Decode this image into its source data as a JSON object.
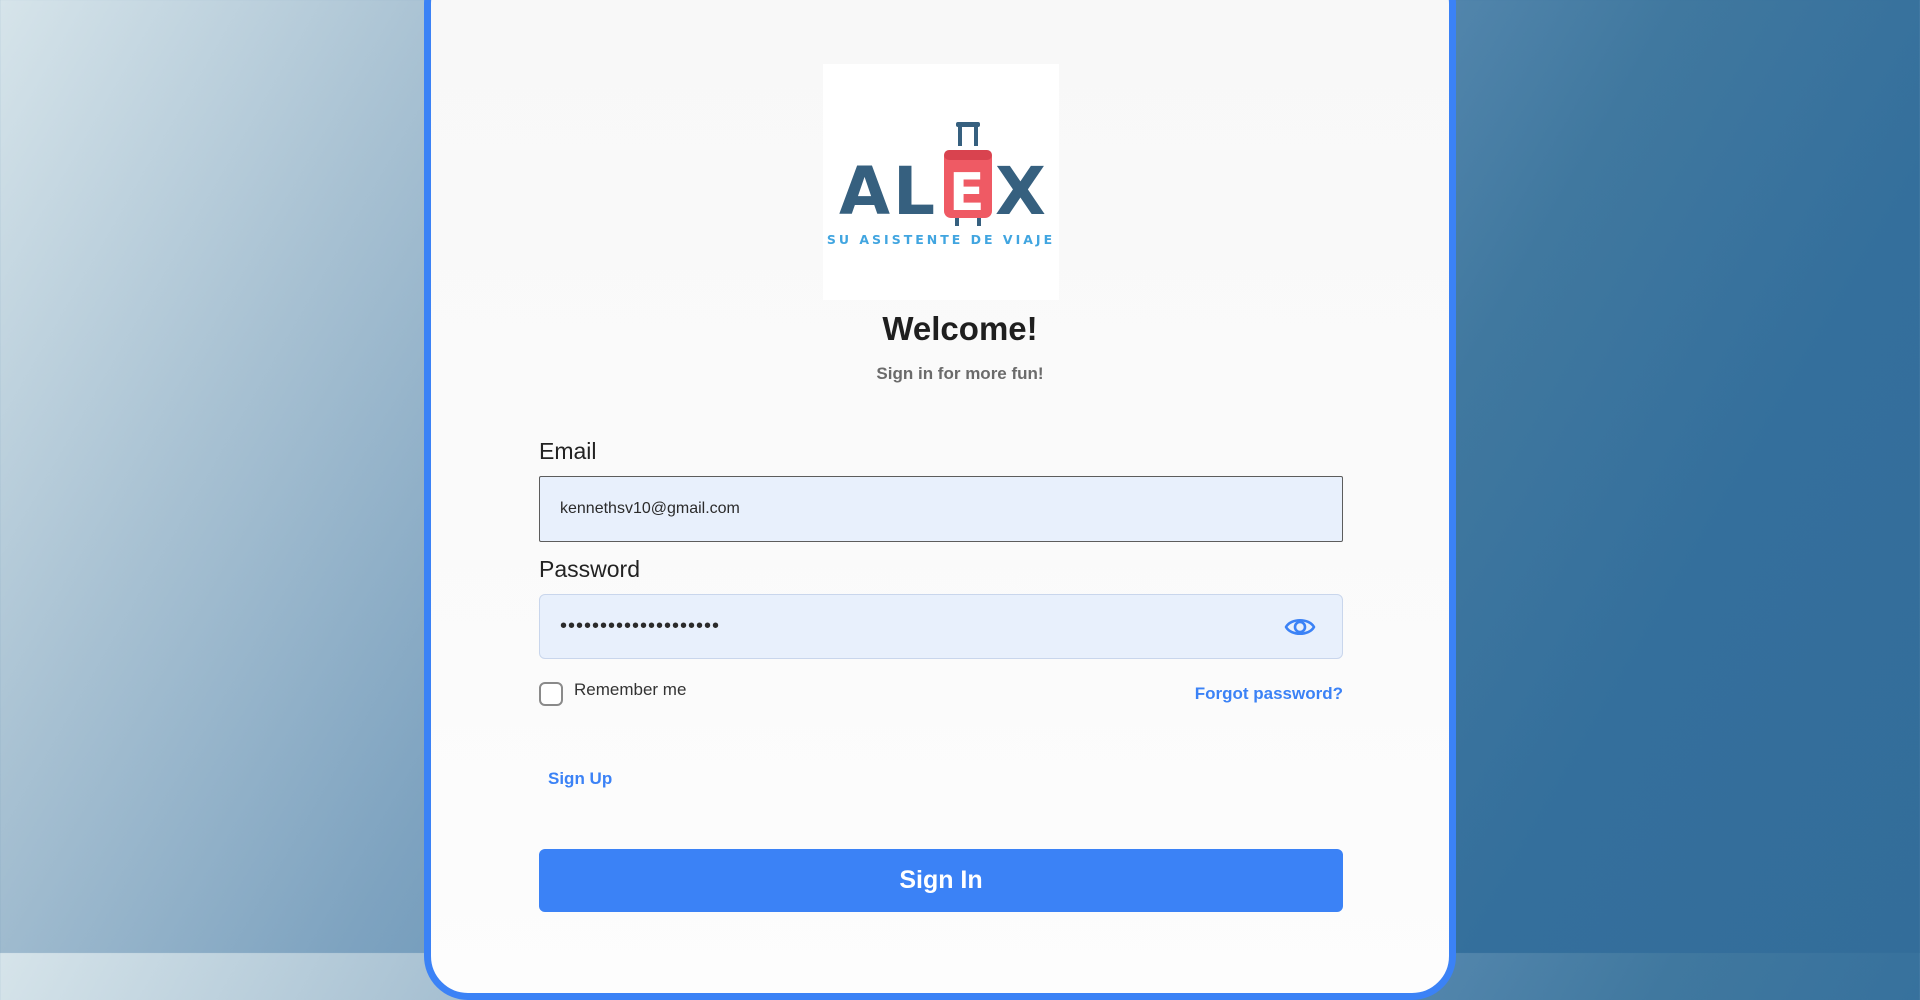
{
  "brand": {
    "logo_word": "ALEX",
    "logo_tagline": "SU ASISTENTE DE VIAJE",
    "primary_color": "#3b82f6",
    "logo_dark_color": "#36607f",
    "logo_accent_color": "#ef5a64",
    "logo_tagline_color": "#41a5e0"
  },
  "header": {
    "title": "Welcome!",
    "subtitle": "Sign in for more fun!"
  },
  "form": {
    "email": {
      "label": "Email",
      "value": "kennethsv10@gmail.com"
    },
    "password": {
      "label": "Password",
      "value": "••••••••••••••••••••",
      "toggle_icon": "eye-icon"
    },
    "remember_me": {
      "label": "Remember me",
      "checked": false
    },
    "forgot_password": "Forgot password?",
    "sign_up": "Sign Up",
    "submit": "Sign In"
  }
}
